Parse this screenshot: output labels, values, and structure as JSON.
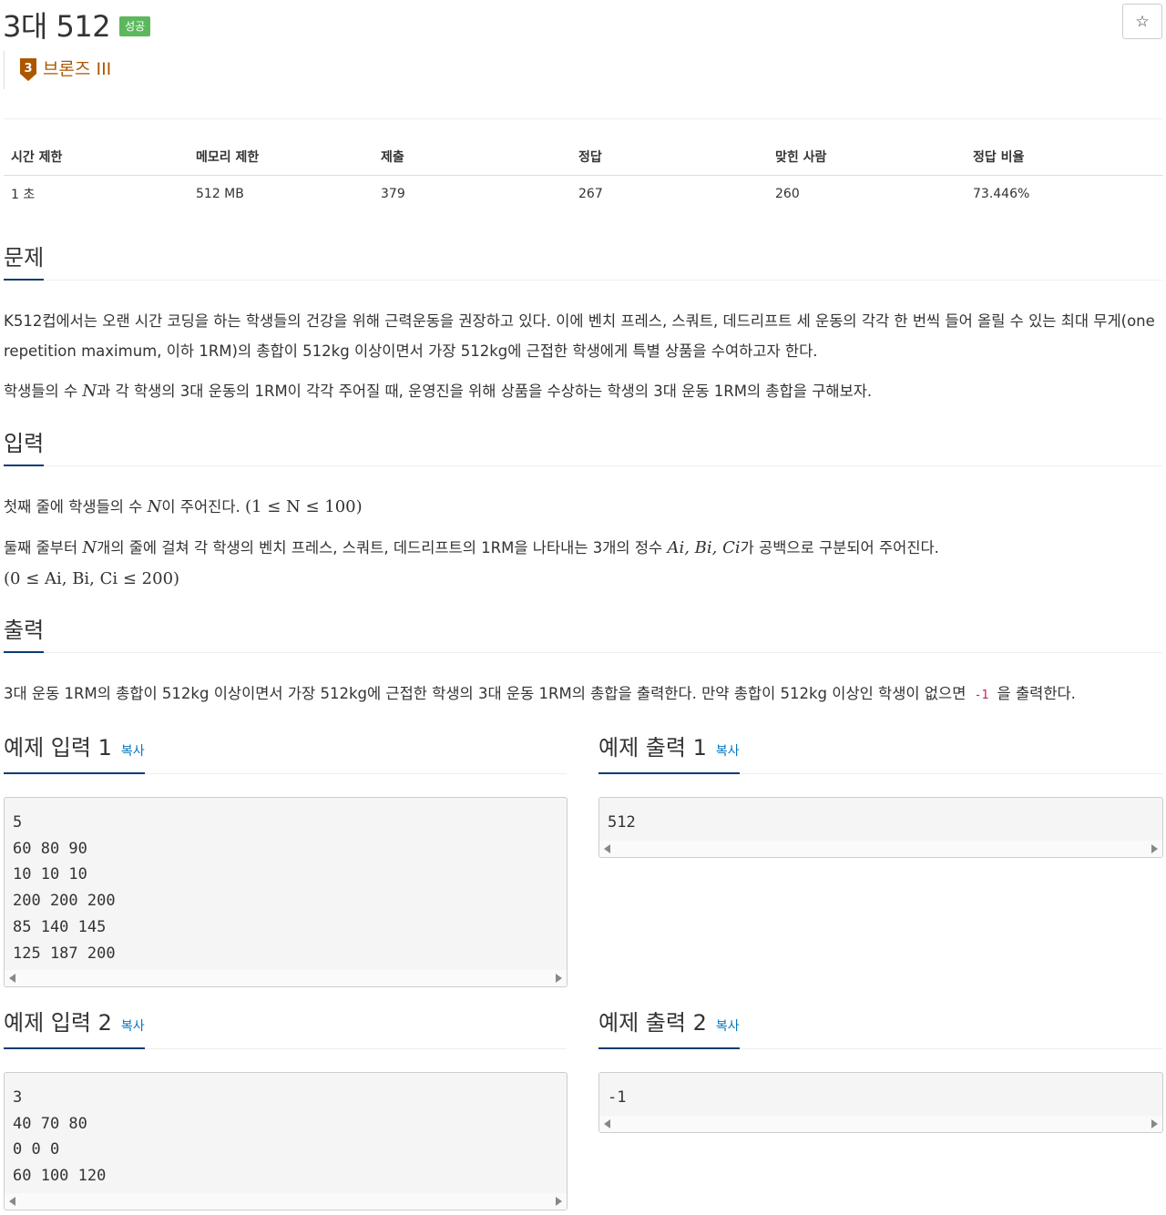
{
  "problem": {
    "title": "3대 512",
    "status_badge": "성공",
    "star_icon": "☆",
    "tier": {
      "number": "3",
      "label": "브론즈 III",
      "color": "#ad5600"
    }
  },
  "info_table": {
    "headers": [
      "시간 제한",
      "메모리 제한",
      "제출",
      "정답",
      "맞힌 사람",
      "정답 비율"
    ],
    "values": [
      "1 초",
      "512 MB",
      "379",
      "267",
      "260",
      "73.446%"
    ]
  },
  "sections": {
    "problem": {
      "heading": "문제",
      "p1": "K512컵에서는 오랜 시간 코딩을 하는 학생들의 건강을 위해 근력운동을 권장하고 있다. 이에 벤치 프레스, 스쿼트, 데드리프트 세 운동의 각각 한 번씩 들어 올릴 수 있는 최대 무게(one repetition maximum, 이하 1RM)의 총합이 512kg 이상이면서 가장 512kg에 근접한 학생에게 특별 상품을 수여하고자 한다.",
      "p2_a": "학생들의 수 ",
      "p2_n": "N",
      "p2_b": "과 각 학생의 3대 운동의 1RM이 각각 주어질 때, 운영진을 위해 상품을 수상하는 학생의 3대 운동 1RM의 총합을 구해보자."
    },
    "input": {
      "heading": "입력",
      "l1_a": "첫째 줄에 학생들의 수 ",
      "l1_n": "N",
      "l1_b": "이 주어진다. ",
      "l1_math": "(1 ≤ N ≤ 100)",
      "l2_a": "둘째 줄부터 ",
      "l2_n": "N",
      "l2_b": "개의 줄에 걸쳐 각 학생의 벤치 프레스, 스쿼트, 데드리프트의 1RM을 나타내는 3개의 정수 ",
      "l2_vars": "Ai, Bi, Ci",
      "l2_c": "가 공백으로 구분되어 주어진다.",
      "l3_math": "(0 ≤ Ai, Bi, Ci ≤ 200)"
    },
    "output": {
      "heading": "출력",
      "text_a": "3대 운동 1RM의 총합이 512kg 이상이면서 가장 512kg에 근접한 학생의 3대 운동 1RM의 총합을 출력한다. 만약 총합이 512kg 이상인 학생이 없으면 ",
      "code": "-1",
      "text_b": " 을 출력한다."
    }
  },
  "samples": {
    "copy_label": "복사",
    "in1_heading": "예제 입력 1",
    "out1_heading": "예제 출력 1",
    "in2_heading": "예제 입력 2",
    "out2_heading": "예제 출력 2",
    "in1": "5\n60 80 90\n10 10 10\n200 200 200\n85 140 145\n125 187 200",
    "out1": "512",
    "in2": "3\n40 70 80\n0 0 0\n60 100 120",
    "out2": "-1"
  }
}
